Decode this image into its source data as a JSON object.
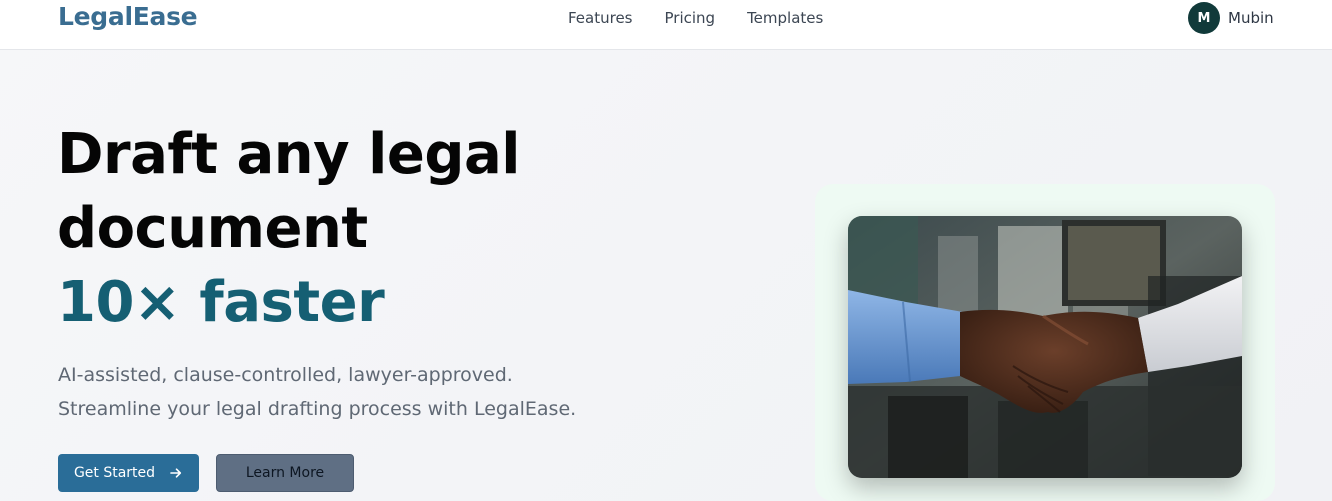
{
  "header": {
    "brand": "LegalEase",
    "nav": [
      {
        "label": "Features"
      },
      {
        "label": "Pricing"
      },
      {
        "label": "Templates"
      }
    ],
    "user": {
      "initial": "M",
      "name": "Mubin"
    }
  },
  "hero": {
    "title_line1": "Draft any legal",
    "title_line2": "document",
    "title_accent": "10× faster",
    "subtitle_line1": "AI-assisted, clause-controlled, lawyer-approved.",
    "subtitle_line2": "Streamline your legal drafting process with LegalEase.",
    "primary_button": "Get Started",
    "secondary_button": "Learn More",
    "image_icon": "handshake-photo"
  },
  "colors": {
    "brand": "#3a6d91",
    "accent": "#155f73",
    "primary_button": "#2a6d98",
    "secondary_button": "#5f6f84",
    "avatar": "#113a3a"
  }
}
